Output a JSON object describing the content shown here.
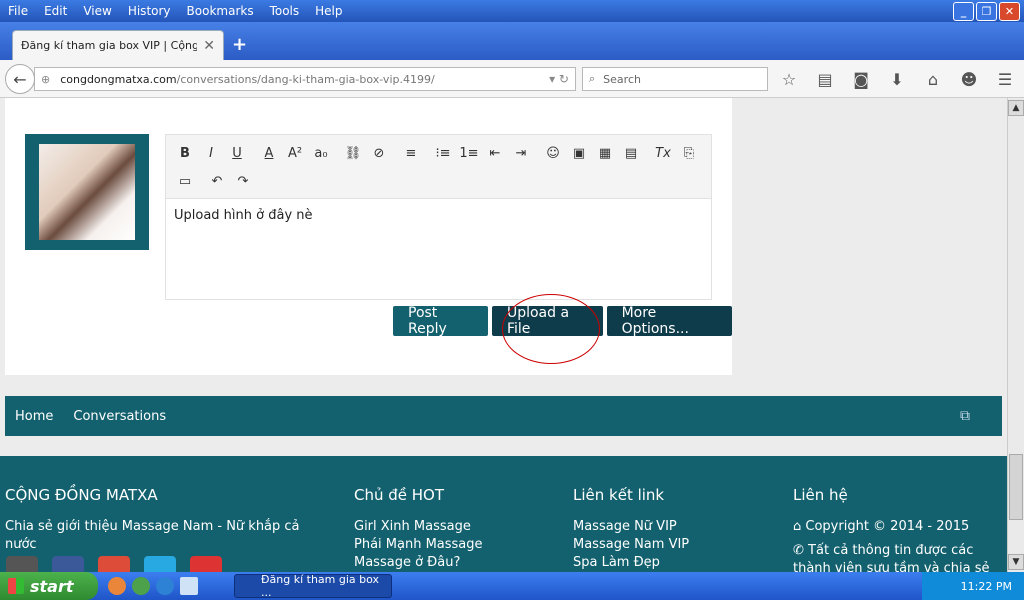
{
  "browser": {
    "menu": [
      "File",
      "Edit",
      "View",
      "History",
      "Bookmarks",
      "Tools",
      "Help"
    ],
    "tab_title": "Đăng kí tham gia box VIP | Cộng đ...",
    "url_host": "congdongmatxa.com",
    "url_path": "/conversations/dang-ki-tham-gia-box-vip.4199/",
    "search_placeholder": "Search"
  },
  "editor": {
    "text": "Upload hình ở đây nè",
    "buttons": {
      "post_reply": "Post Reply",
      "upload_file": "Upload a File",
      "more_options": "More Options..."
    }
  },
  "nav_strip": {
    "items": [
      "Home",
      "Conversations"
    ]
  },
  "footer": {
    "col1": {
      "heading": "CỘNG ĐỒNG MATXA",
      "text": "Chia sẻ giới thiệu Massage Nam - Nữ khắp cả nước"
    },
    "col2": {
      "heading": "Chủ đề HOT",
      "links": [
        "Girl Xinh Massage",
        "Phái Mạnh Massage",
        "Massage ở Đâu?"
      ]
    },
    "col3": {
      "heading": "Liên kết link",
      "links": [
        "Massage Nữ VIP",
        "Massage Nam VIP",
        "Spa Làm Đẹp"
      ]
    },
    "col4": {
      "heading": "Liên hệ",
      "copyright": "Copyright © 2014 - 2015",
      "info": "Tất cả thông tin được các thành viên sưu tầm và chia sẻ"
    }
  },
  "taskbar": {
    "start": "start",
    "window": "Đăng kí tham gia box ...",
    "time": "11:22 PM"
  },
  "colors": {
    "teal": "#13616e",
    "dark_teal": "#0f3c4a",
    "highlight": "#cc0000"
  }
}
